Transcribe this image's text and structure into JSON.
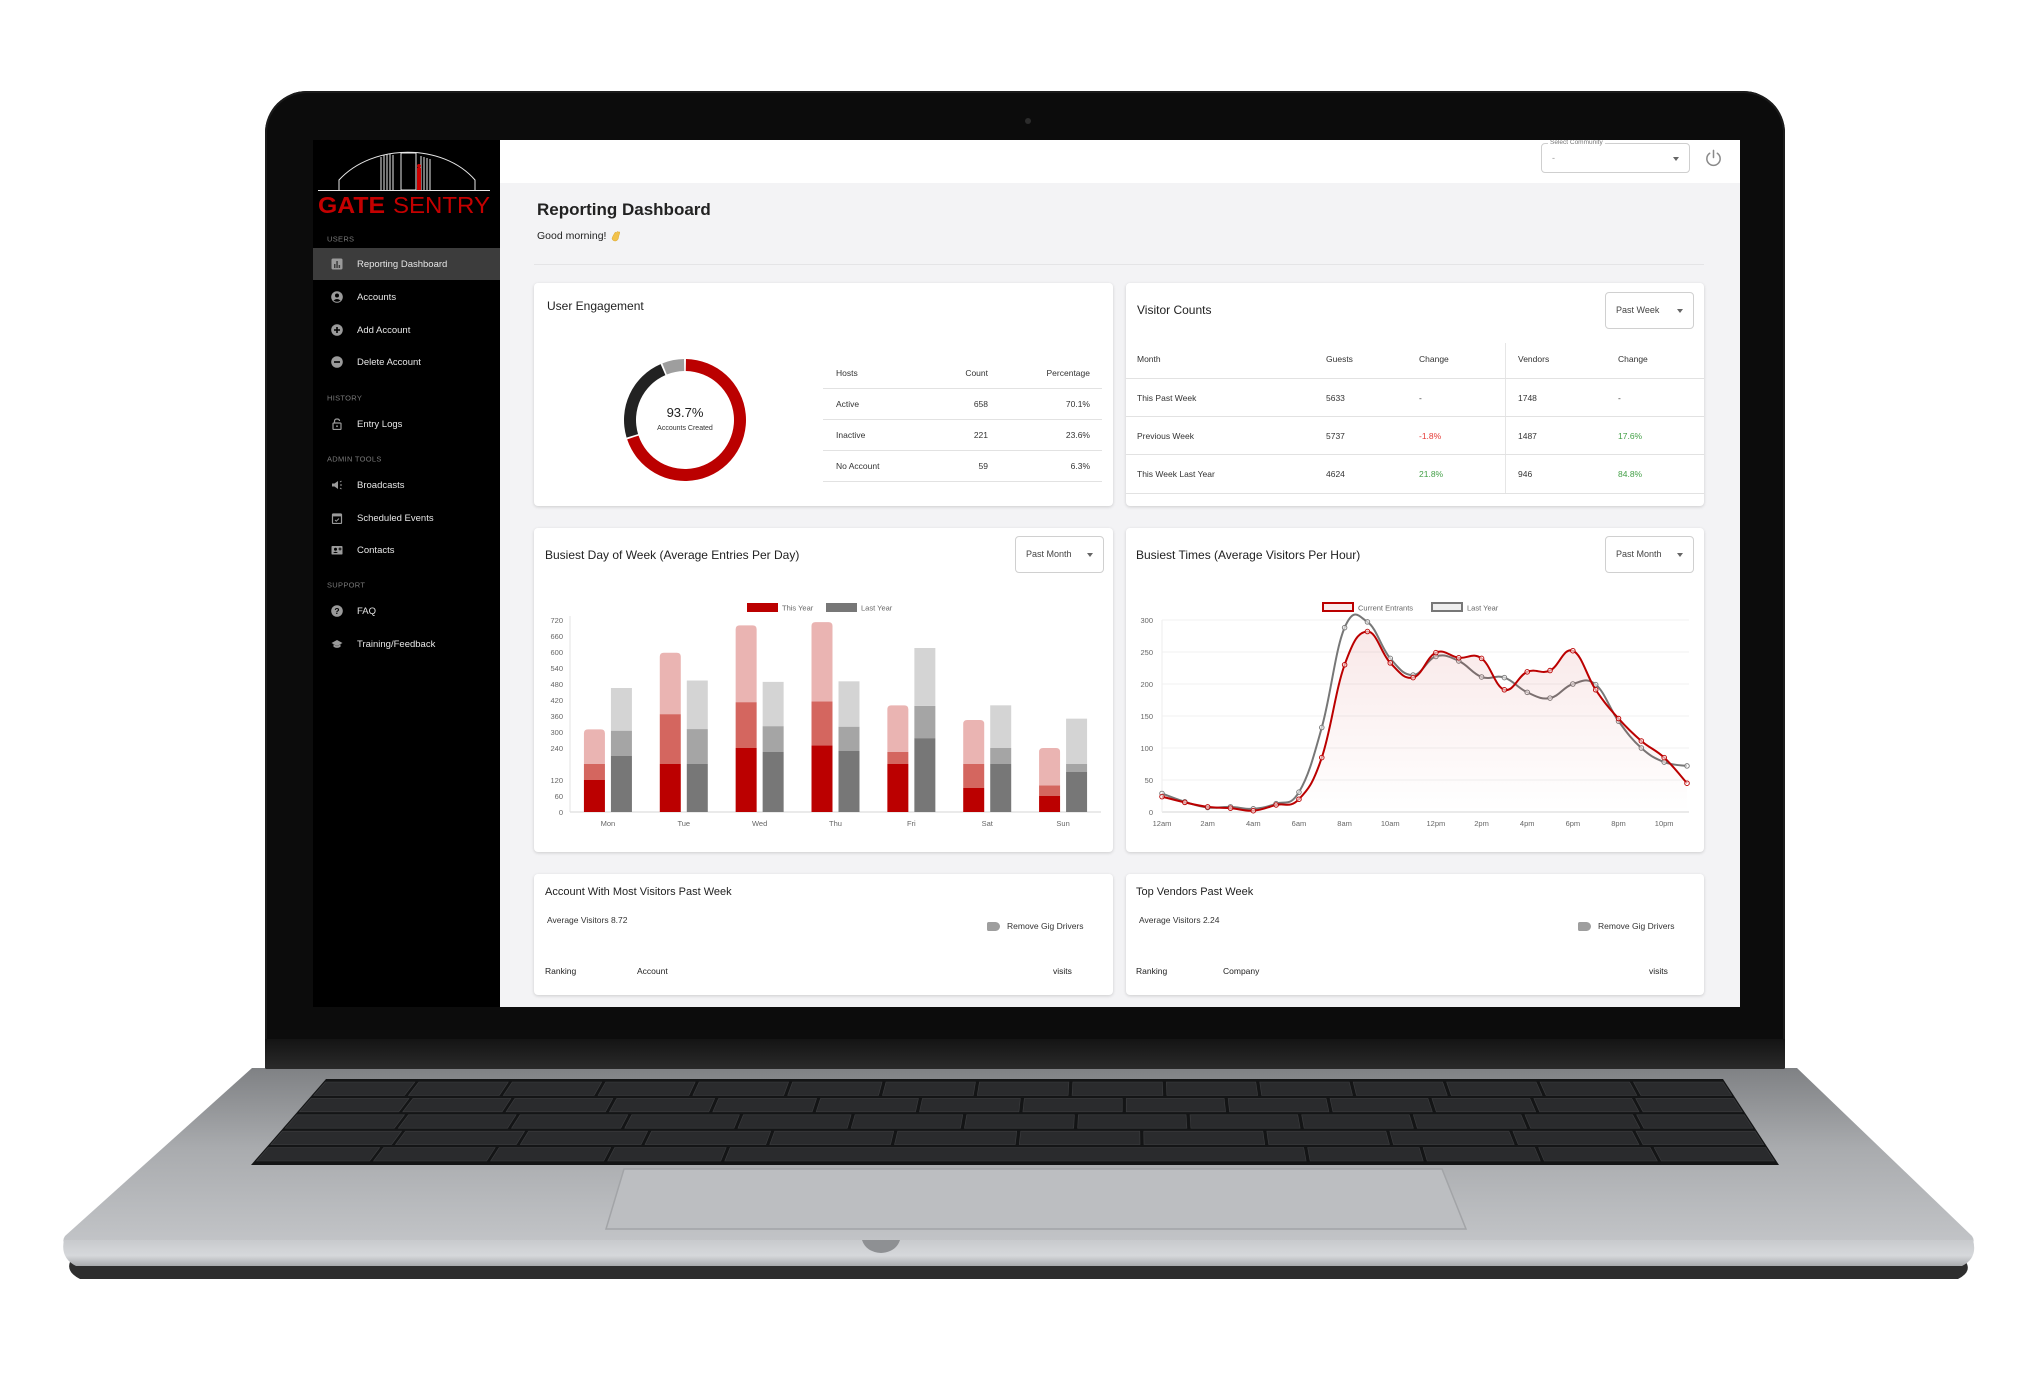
{
  "brand": {
    "word1": "GATE",
    "word2": "SENTRY"
  },
  "header": {
    "community_select": {
      "label": "Select Community",
      "value": "-"
    },
    "power_icon": "power-icon"
  },
  "page": {
    "title": "Reporting Dashboard",
    "greeting": "Good morning!",
    "greeting_icon": "waving-hand-icon"
  },
  "sidebar": {
    "sections": [
      {
        "title": "USERS",
        "items": [
          {
            "label": "Reporting Dashboard",
            "icon": "chart-bar-icon",
            "active": true
          },
          {
            "label": "Accounts",
            "icon": "account-circle-icon"
          },
          {
            "label": "Add Account",
            "icon": "plus-circle-icon"
          },
          {
            "label": "Delete Account",
            "icon": "minus-circle-icon"
          }
        ]
      },
      {
        "title": "HISTORY",
        "items": [
          {
            "label": "Entry Logs",
            "icon": "lock-open-icon"
          }
        ]
      },
      {
        "title": "ADMIN TOOLS",
        "items": [
          {
            "label": "Broadcasts",
            "icon": "megaphone-icon"
          },
          {
            "label": "Scheduled Events",
            "icon": "calendar-check-icon"
          },
          {
            "label": "Contacts",
            "icon": "contact-card-icon"
          }
        ]
      },
      {
        "title": "SUPPORT",
        "items": [
          {
            "label": "FAQ",
            "icon": "help-circle-icon"
          },
          {
            "label": "Training/Feedback",
            "icon": "graduation-cap-icon"
          }
        ]
      }
    ]
  },
  "user_engagement": {
    "title": "User Engagement",
    "table": {
      "headers": [
        "Hosts",
        "Count",
        "Percentage"
      ],
      "rows": [
        [
          "Active",
          "658",
          "70.1%"
        ],
        [
          "Inactive",
          "221",
          "23.6%"
        ],
        [
          "No Account",
          "59",
          "6.3%"
        ]
      ]
    }
  },
  "visitor_counts": {
    "title": "Visitor Counts",
    "period_select": "Past Week",
    "headers": [
      "Month",
      "Guests",
      "Change",
      "Vendors",
      "Change"
    ],
    "rows": [
      {
        "label": "This Past Week",
        "guests": "5633",
        "guests_change": {
          "text": "-",
          "trend": "none"
        },
        "vendors": "1748",
        "vendors_change": {
          "text": "-",
          "trend": "none"
        }
      },
      {
        "label": "Previous Week",
        "guests": "5737",
        "guests_change": {
          "text": "-1.8%",
          "trend": "down"
        },
        "vendors": "1487",
        "vendors_change": {
          "text": "17.6%",
          "trend": "up"
        }
      },
      {
        "label": "This Week Last Year",
        "guests": "4624",
        "guests_change": {
          "text": "21.8%",
          "trend": "up"
        },
        "vendors": "946",
        "vendors_change": {
          "text": "84.8%",
          "trend": "up"
        }
      }
    ]
  },
  "busiest_day": {
    "period_select": "Past Month"
  },
  "busiest_times": {
    "period_select": "Past Month"
  },
  "account_card": {
    "title": "Account With Most Visitors Past Week",
    "average": "Average Visitors 8.72",
    "toggle_label": "Remove Gig Drivers",
    "toggle_on": false,
    "headers": [
      "Ranking",
      "Account",
      "visits"
    ]
  },
  "vendor_card": {
    "title": "Top Vendors Past Week",
    "average": "Average Visitors 2.24",
    "toggle_label": "Remove Gig Drivers",
    "toggle_on": false,
    "headers": [
      "Ranking",
      "Company",
      "visits"
    ]
  },
  "theme": {
    "accent": "#bb0000",
    "positive": "#43a047",
    "negative": "#e53935",
    "sidebar_bg": "#000000",
    "sidebar_active": "#3c3c3c",
    "page_bg": "#f3f3f5"
  },
  "chart_data": [
    {
      "id": "user-engagement",
      "type": "pie",
      "variant": "donut",
      "title": "User Engagement",
      "labels": [
        "Active",
        "Inactive",
        "No Account"
      ],
      "values": [
        70.1,
        23.6,
        6.3
      ],
      "colors": [
        "#bb0000",
        "#222222",
        "#9e9e9e"
      ],
      "center_text": "93.7%",
      "center_label": "Accounts Created"
    },
    {
      "id": "busiest-day",
      "type": "bar",
      "stacked": true,
      "title": "Busiest Day of Week (Average Entries Per Day)",
      "xlabel": "",
      "ylabel": "",
      "categories": [
        "Mon",
        "Tue",
        "Wed",
        "Thu",
        "Fri",
        "Sat",
        "Sun"
      ],
      "series": [
        {
          "name": "This Year",
          "color": "#bb0000",
          "segment_colors": [
            "#bb0000",
            "#d4665f",
            "#eab4b2"
          ],
          "values": [
            [
              120,
              60,
              130
            ],
            [
              180,
              187,
              230
            ],
            [
              240,
              172,
              288
            ],
            [
              250,
              165,
              297
            ],
            [
              180,
              45,
              175
            ],
            [
              90,
              90,
              165
            ],
            [
              60,
              40,
              140
            ]
          ]
        },
        {
          "name": "Last Year",
          "color": "#777777",
          "segment_colors": [
            "#777777",
            "#a5a5a5",
            "#d4d4d4"
          ],
          "values": [
            [
              210,
              95,
              160
            ],
            [
              180,
              131,
              182
            ],
            [
              225,
              97,
              166
            ],
            [
              230,
              90,
              170
            ],
            [
              277,
              121,
              217
            ],
            [
              180,
              60,
              160
            ],
            [
              150,
              30,
              170
            ]
          ]
        }
      ],
      "ylim": [
        0,
        720
      ],
      "yticks": [
        0,
        60,
        120,
        240,
        300,
        360,
        420,
        480,
        540,
        600,
        660,
        720
      ],
      "grid": false,
      "legend": "top-center"
    },
    {
      "id": "busiest-times",
      "type": "line",
      "title": "Busiest Times (Average Visitors Per Hour)",
      "xlabel": "",
      "ylabel": "",
      "x": [
        "12am",
        "1am",
        "2am",
        "3am",
        "4am",
        "5am",
        "6am",
        "7am",
        "8am",
        "9am",
        "10am",
        "11am",
        "12pm",
        "1pm",
        "2pm",
        "3pm",
        "4pm",
        "5pm",
        "6pm",
        "7pm",
        "8pm",
        "9pm",
        "10pm",
        "11pm"
      ],
      "xticks": [
        "12am",
        "2am",
        "4am",
        "6am",
        "8am",
        "10am",
        "12pm",
        "2pm",
        "4pm",
        "6pm",
        "8pm",
        "10pm"
      ],
      "series": [
        {
          "name": "Current Entrants",
          "color": "#bb0000",
          "fill": true,
          "values": [
            24,
            15,
            8,
            6,
            2,
            11,
            20,
            85,
            230,
            282,
            233,
            210,
            249,
            241,
            240,
            191,
            219,
            221,
            252,
            191,
            146,
            111,
            85,
            45
          ]
        },
        {
          "name": "Last Year",
          "color": "#777777",
          "fill": false,
          "values": [
            29,
            16,
            7,
            8,
            5,
            13,
            31,
            132,
            288,
            297,
            240,
            214,
            243,
            236,
            211,
            210,
            187,
            178,
            200,
            199,
            142,
            100,
            78,
            72
          ]
        }
      ],
      "ylim": [
        0,
        300
      ],
      "yticks": [
        0,
        50,
        100,
        150,
        200,
        250,
        300
      ],
      "grid": true,
      "legend": "top-center"
    }
  ]
}
